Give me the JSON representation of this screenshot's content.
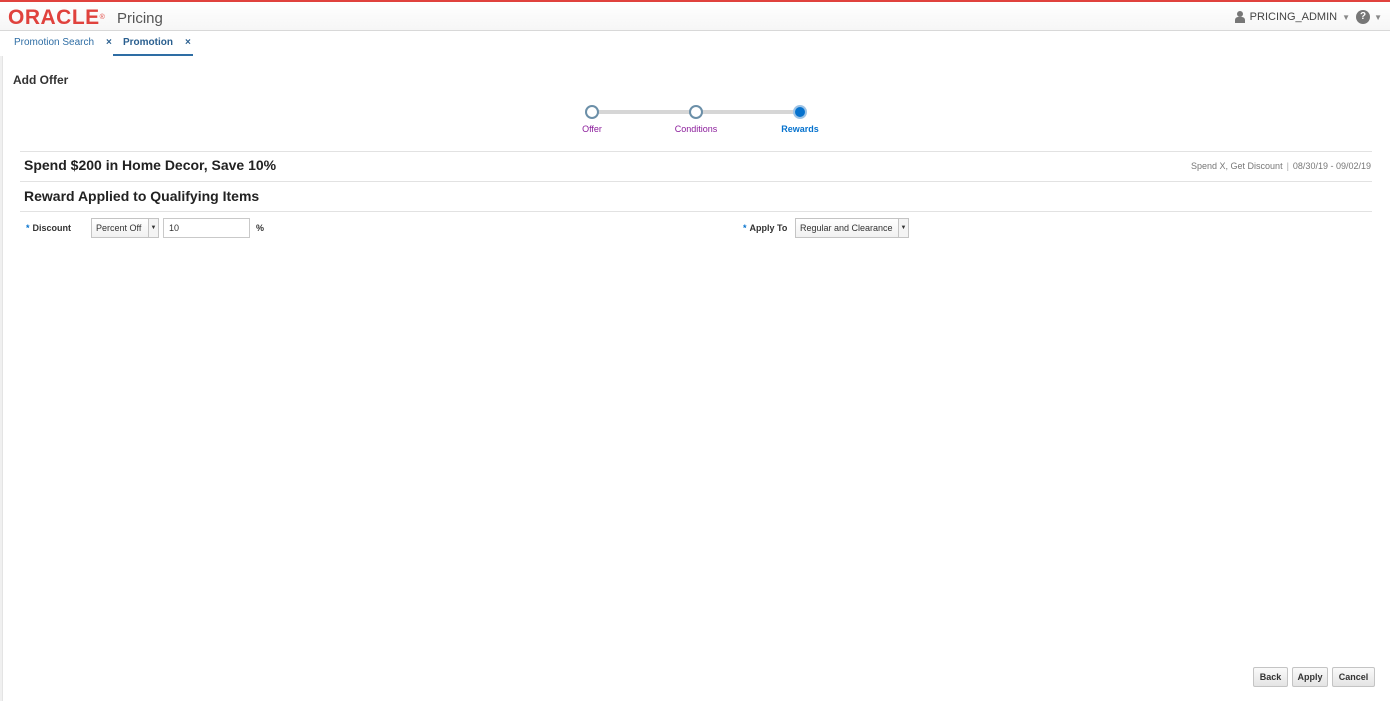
{
  "header": {
    "logo_text": "ORACLE",
    "logo_mark": "®",
    "app_name": "Pricing",
    "user_name": "PRICING_ADMIN",
    "user_icon": "user-icon",
    "help_icon": "help-icon"
  },
  "tabs": [
    {
      "label": "Promotion Search",
      "close": "×",
      "active": false
    },
    {
      "label": "Promotion",
      "close": "×",
      "active": true
    }
  ],
  "page": {
    "title": "Add Offer"
  },
  "train": {
    "stops": [
      {
        "label": "Offer",
        "state": "visited"
      },
      {
        "label": "Conditions",
        "state": "visited"
      },
      {
        "label": "Rewards",
        "state": "current"
      }
    ]
  },
  "offer": {
    "title": "Spend $200 in Home Decor, Save 10%",
    "type": "Spend X, Get Discount",
    "separator": "|",
    "date_range": "08/30/19 - 09/02/19"
  },
  "section": {
    "title": "Reward Applied to Qualifying Items"
  },
  "form": {
    "required_mark": "*",
    "discount_label": "Discount",
    "discount_type": "Percent Off",
    "discount_value": "10",
    "discount_unit": "%",
    "apply_to_label": "Apply To",
    "apply_to_value": "Regular and Clearance"
  },
  "buttons": {
    "back": "Back",
    "apply": "Apply",
    "cancel": "Cancel"
  },
  "colors": {
    "brand_red": "#e0423d",
    "accent_blue": "#0572ce",
    "visited_purple": "#8b1c9b"
  }
}
